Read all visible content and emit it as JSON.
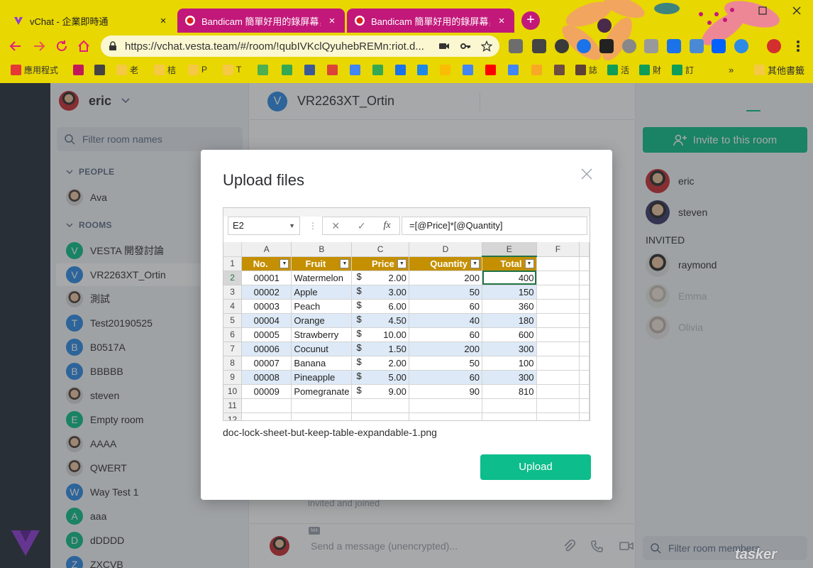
{
  "browser": {
    "tabs": [
      {
        "title": "vChat - 企業即時通",
        "close": "×"
      },
      {
        "title": "Bandicam 簡單好用的錄屏幕，輕",
        "close": "×"
      },
      {
        "title": "Bandicam 簡單好用的錄屏幕，輕",
        "close": "×"
      }
    ],
    "new_tab": "+",
    "url": "https://vchat.vesta.team/#/room/!qubIVKclQyuhebREMn:riot.d...",
    "bookmarks": [
      {
        "label": "應用程式",
        "color": "#e53935"
      },
      {
        "label": "",
        "color": "#c2185b"
      },
      {
        "label": "",
        "color": "#444444"
      },
      {
        "label": "老",
        "color": "#f6c945"
      },
      {
        "label": "桔",
        "color": "#f6c945"
      },
      {
        "label": "P",
        "color": "#f6c945"
      },
      {
        "label": "T",
        "color": "#f6c945"
      },
      {
        "label": "",
        "color": "#4caf50"
      },
      {
        "label": "",
        "color": "#34a853"
      },
      {
        "label": "",
        "color": "#3b5998"
      },
      {
        "label": "",
        "color": "#db4437"
      },
      {
        "label": "",
        "color": "#4285f4"
      },
      {
        "label": "",
        "color": "#34a853"
      },
      {
        "label": "",
        "color": "#1a73e8"
      },
      {
        "label": "",
        "color": "#1e88e5"
      },
      {
        "label": "",
        "color": "#fbbc05"
      },
      {
        "label": "",
        "color": "#4285f4"
      },
      {
        "label": "",
        "color": "#ff0000"
      },
      {
        "label": "",
        "color": "#4285f4"
      },
      {
        "label": "",
        "color": "#f9a825"
      },
      {
        "label": "",
        "color": "#6d4c41"
      },
      {
        "label": "誌",
        "color": "#5d4037"
      },
      {
        "label": "活",
        "color": "#0f9d58"
      },
      {
        "label": "財",
        "color": "#0f9d58"
      },
      {
        "label": "訂",
        "color": "#0f9d58"
      }
    ],
    "more_bookmarks": "»",
    "other_bookmarks": "其他書籤"
  },
  "user": {
    "name": "eric"
  },
  "roomlist": {
    "filter_placeholder": "Filter room names",
    "people_header": "PEOPLE",
    "rooms_header": "ROOMS",
    "people": [
      {
        "name": "Ava"
      }
    ],
    "rooms": [
      {
        "name": "VESTA 開發討論",
        "letter": "V",
        "color": "#0dbd8b"
      },
      {
        "name": "VR2263XT_Ortin",
        "letter": "V",
        "color": "#2d8be6"
      },
      {
        "name": "測試",
        "letter": "",
        "color": ""
      },
      {
        "name": "Test20190525",
        "letter": "T",
        "color": "#2d8be6"
      },
      {
        "name": "B0517A",
        "letter": "B",
        "color": "#2d8be6"
      },
      {
        "name": "BBBBB",
        "letter": "B",
        "color": "#2d8be6"
      },
      {
        "name": "steven",
        "letter": "",
        "color": ""
      },
      {
        "name": "Empty room",
        "letter": "E",
        "color": "#0dbd8b"
      },
      {
        "name": "AAAA",
        "letter": "",
        "color": ""
      },
      {
        "name": "QWERT",
        "letter": "",
        "color": ""
      },
      {
        "name": "Way Test 1",
        "letter": "W",
        "color": "#2d8be6"
      },
      {
        "name": "aaa",
        "letter": "A",
        "color": "#0dbd8b"
      },
      {
        "name": "dDDDD",
        "letter": "D",
        "color": "#0dbd8b"
      },
      {
        "name": "ZXCVB",
        "letter": "Z",
        "color": "#2d8be6"
      }
    ]
  },
  "room": {
    "name": "VR2263XT_Ortin",
    "letter": "V",
    "ghost_event": "invited and joined",
    "ghost_badge": "M4",
    "composer_placeholder": "Send a message (unencrypted)..."
  },
  "members": {
    "invite_label": "Invite to this room",
    "joined": [
      {
        "name": "eric"
      },
      {
        "name": "steven"
      }
    ],
    "invited_label": "INVITED",
    "invited": [
      {
        "name": "raymond"
      },
      {
        "name": "Emma"
      },
      {
        "name": "Olivia"
      }
    ],
    "filter_placeholder": "Filter room members"
  },
  "watermark": "tasker",
  "dialog": {
    "title": "Upload files",
    "close": "×",
    "filename": "doc-lock-sheet-but-keep-table-expandable-1.png",
    "upload_label": "Upload",
    "spreadsheet": {
      "name_box": "E2",
      "formula": "=[@Price]*[@Quantity]",
      "columns": [
        "A",
        "B",
        "C",
        "D",
        "E",
        "F"
      ],
      "headers": [
        "No.",
        "Fruit",
        "Price",
        "Quantity",
        "Total"
      ],
      "rows": [
        {
          "no": "00001",
          "fruit": "Watermelon",
          "cur": "$",
          "price": "2.00",
          "qty": "200",
          "total": "400"
        },
        {
          "no": "00002",
          "fruit": "Apple",
          "cur": "$",
          "price": "3.00",
          "qty": "50",
          "total": "150"
        },
        {
          "no": "00003",
          "fruit": "Peach",
          "cur": "$",
          "price": "6.00",
          "qty": "60",
          "total": "360"
        },
        {
          "no": "00004",
          "fruit": "Orange",
          "cur": "$",
          "price": "4.50",
          "qty": "40",
          "total": "180"
        },
        {
          "no": "00005",
          "fruit": "Strawberry",
          "cur": "$",
          "price": "10.00",
          "qty": "60",
          "total": "600"
        },
        {
          "no": "00006",
          "fruit": "Cocunut",
          "cur": "$",
          "price": "1.50",
          "qty": "200",
          "total": "300"
        },
        {
          "no": "00007",
          "fruit": "Banana",
          "cur": "$",
          "price": "2.00",
          "qty": "50",
          "total": "100"
        },
        {
          "no": "00008",
          "fruit": "Pineapple",
          "cur": "$",
          "price": "5.00",
          "qty": "60",
          "total": "300"
        },
        {
          "no": "00009",
          "fruit": "Pomegranate",
          "cur": "$",
          "price": "9.00",
          "qty": "90",
          "total": "810"
        }
      ],
      "row_numbers": [
        "1",
        "2",
        "3",
        "4",
        "5",
        "6",
        "7",
        "8",
        "9",
        "10",
        "11",
        "12"
      ]
    }
  }
}
